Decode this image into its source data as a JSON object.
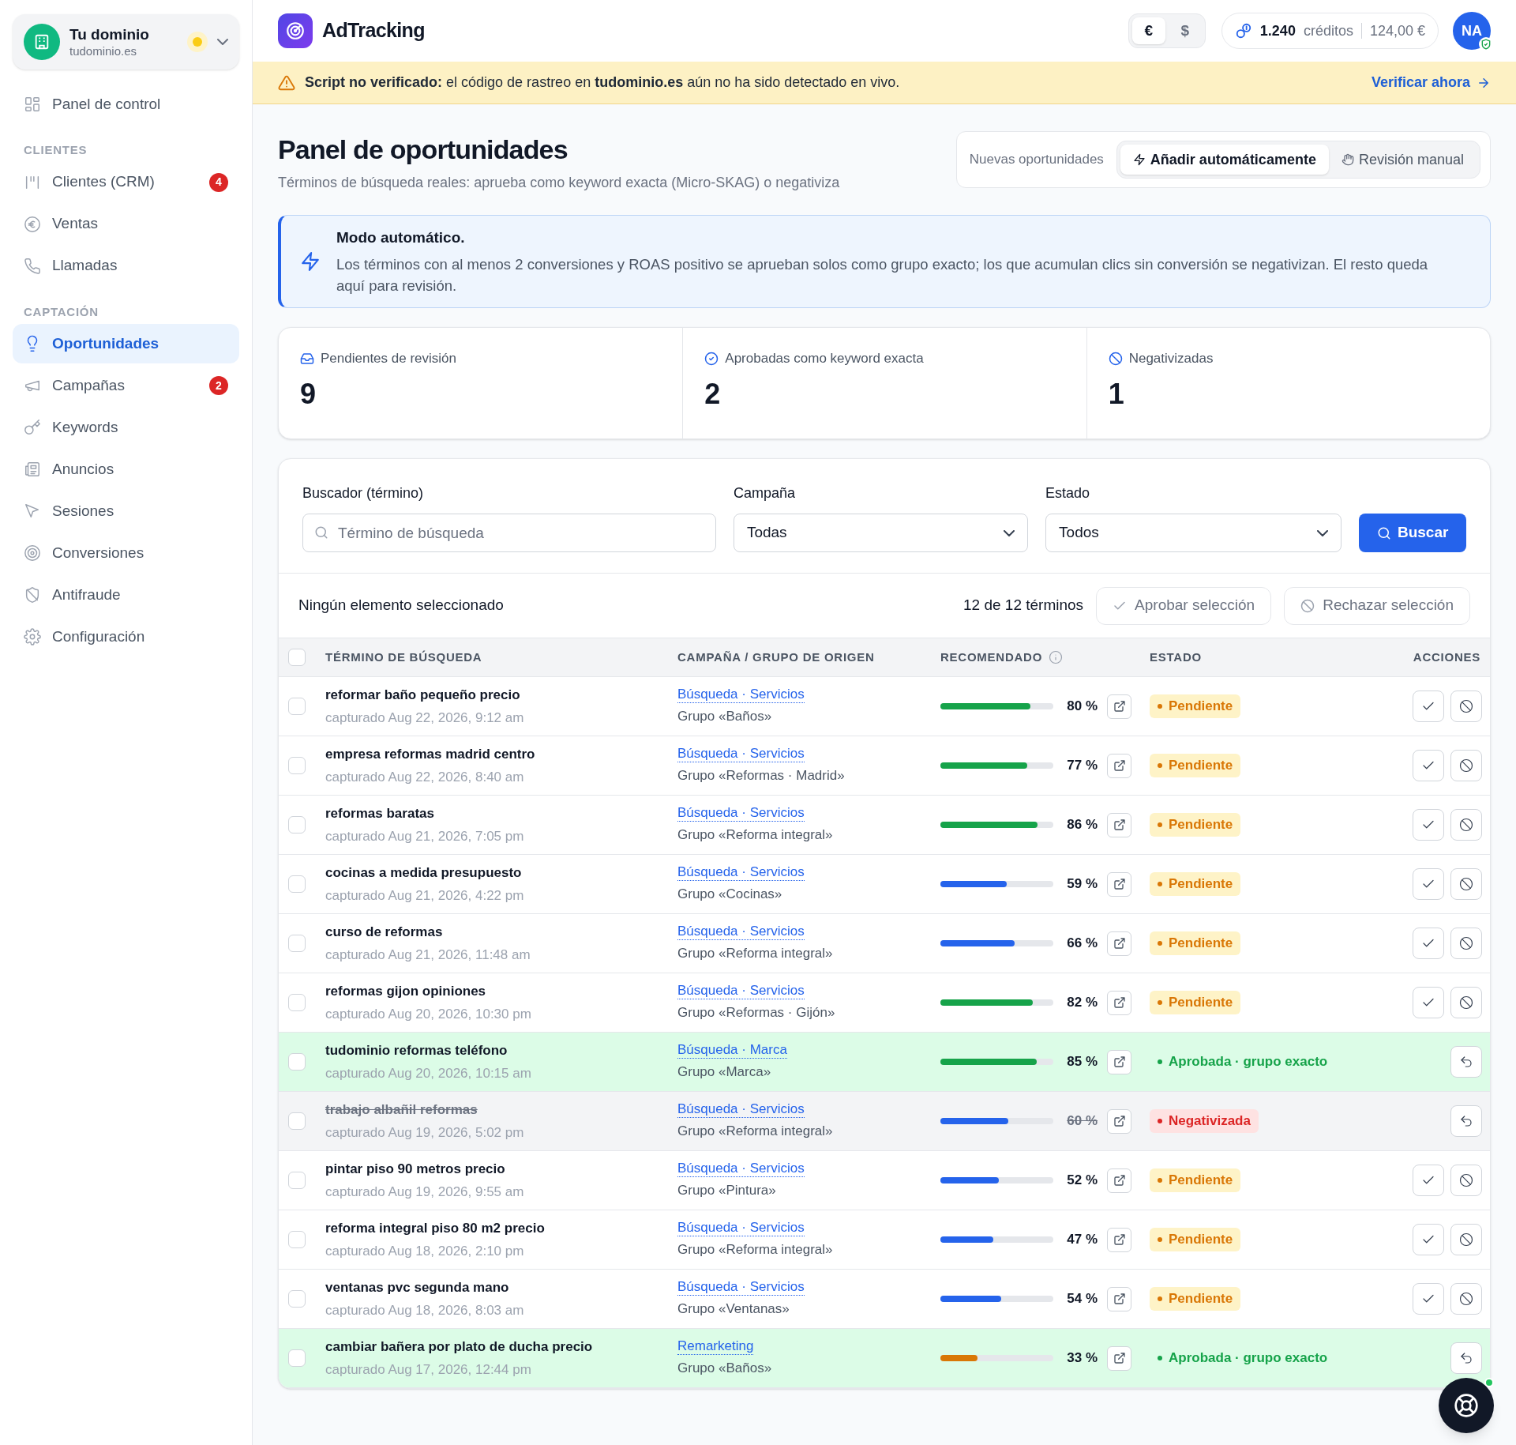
{
  "workspace": {
    "name": "Tu dominio",
    "domain": "tudominio.es"
  },
  "sidebar": {
    "top_items": [
      {
        "label": "Panel de control",
        "selected": false
      }
    ],
    "sections": [
      {
        "title": "CLIENTES",
        "items": [
          {
            "label": "Clientes (CRM)",
            "badge": "4",
            "selected": false
          },
          {
            "label": "Ventas",
            "selected": false
          },
          {
            "label": "Llamadas",
            "selected": false
          }
        ]
      },
      {
        "title": "CAPTACIÓN",
        "items": [
          {
            "label": "Oportunidades",
            "selected": true
          },
          {
            "label": "Campañas",
            "badge": "2",
            "selected": false
          },
          {
            "label": "Keywords",
            "selected": false
          },
          {
            "label": "Anuncios",
            "selected": false
          },
          {
            "label": "Sesiones",
            "selected": false
          },
          {
            "label": "Conversiones",
            "selected": false
          },
          {
            "label": "Antifraude",
            "selected": false
          },
          {
            "label": "Configuración",
            "selected": false
          }
        ]
      }
    ]
  },
  "topbar": {
    "brand": "AdTracking",
    "currencies": [
      {
        "label": "€",
        "selected": true
      },
      {
        "label": "$",
        "selected": false
      }
    ],
    "credits": "1.240",
    "credits_label": "créditos",
    "balance": "124,00 €",
    "avatar": "NA"
  },
  "banner": {
    "text": "**Script no verificado:** el código de rastreo en **tudominio.es** aún no ha sido detectado en vivo.",
    "link": "Verificar ahora"
  },
  "header": {
    "title": "Panel de oportunidades",
    "subtitle": "Términos de búsqueda reales: aprueba como keyword exacta (Micro-SKAG) o negativiza",
    "mode_label": "Nuevas oportunidades",
    "modes": [
      {
        "label": "Añadir automáticamente",
        "selected": true
      },
      {
        "label": "Revisión manual",
        "selected": false
      }
    ]
  },
  "info": {
    "title": "Modo automático.",
    "text": "Los términos con al menos 2 conversiones y ROAS positivo se aprueban solos como grupo exacto; los que acumulan clics sin conversión se negativizan. El resto queda aquí para revisión."
  },
  "stats": [
    {
      "label": "Pendientes de revisión",
      "value": "9"
    },
    {
      "label": "Aprobadas como keyword exacta",
      "value": "2"
    },
    {
      "label": "Negativizadas",
      "value": "1"
    }
  ],
  "filters": {
    "search_label": "Buscador (término)",
    "search_placeholder": "Término de búsqueda",
    "campaign_label": "Campaña",
    "campaign_value": "Todas",
    "status_label": "Estado",
    "status_value": "Todos",
    "button": "Buscar"
  },
  "bulk": {
    "selection": "Ningún elemento seleccionado",
    "count": "12 de 12 términos",
    "approve": "Aprobar selección",
    "reject": "Rechazar selección",
    "disabled": true
  },
  "table": {
    "select_all_checked": false,
    "columns": [
      "TÉRMINO DE BÚSQUEDA",
      "CAMPAÑA / GRUPO DE ORIGEN",
      "RECOMENDADO",
      "ESTADO",
      "ACCIONES"
    ],
    "rows": [
      {
        "term": "reformar baño pequeño precio",
        "captured": "capturado Aug 22, 2026, 9:12 am",
        "campaign": "Búsqueda · Servicios",
        "group": "Grupo «Baños»",
        "level": 0.8,
        "percent": "80 %",
        "status": {
          "kind": "pending",
          "label": "Pendiente"
        },
        "checked": false
      },
      {
        "term": "empresa reformas madrid centro",
        "captured": "capturado Aug 22, 2026, 8:40 am",
        "campaign": "Búsqueda · Servicios",
        "group": "Grupo «Reformas · Madrid»",
        "level": 0.77,
        "percent": "77 %",
        "status": {
          "kind": "pending",
          "label": "Pendiente"
        },
        "checked": false
      },
      {
        "term": "reformas baratas",
        "captured": "capturado Aug 21, 2026, 7:05 pm",
        "campaign": "Búsqueda · Servicios",
        "group": "Grupo «Reforma integral»",
        "level": 0.86,
        "percent": "86 %",
        "status": {
          "kind": "pending",
          "label": "Pendiente"
        },
        "checked": false
      },
      {
        "term": "cocinas a medida presupuesto",
        "captured": "capturado Aug 21, 2026, 4:22 pm",
        "campaign": "Búsqueda · Servicios",
        "group": "Grupo «Cocinas»",
        "level": 0.59,
        "percent": "59 %",
        "status": {
          "kind": "pending",
          "label": "Pendiente"
        },
        "checked": false
      },
      {
        "term": "curso de reformas",
        "captured": "capturado Aug 21, 2026, 11:48 am",
        "campaign": "Búsqueda · Servicios",
        "group": "Grupo «Reforma integral»",
        "level": 0.66,
        "percent": "66 %",
        "status": {
          "kind": "pending",
          "label": "Pendiente"
        },
        "checked": false
      },
      {
        "term": "reformas gijon opiniones",
        "captured": "capturado Aug 20, 2026, 10:30 pm",
        "campaign": "Búsqueda · Servicios",
        "group": "Grupo «Reformas · Gijón»",
        "level": 0.82,
        "percent": "82 %",
        "status": {
          "kind": "pending",
          "label": "Pendiente"
        },
        "checked": false
      },
      {
        "term": "tudominio reformas teléfono",
        "captured": "capturado Aug 20, 2026, 10:15 am",
        "campaign": "Búsqueda · Marca",
        "group": "Grupo «Marca»",
        "level": 0.85,
        "percent": "85 %",
        "status": {
          "kind": "approved",
          "label": "Aprobada · grupo exacto"
        },
        "checked": false
      },
      {
        "term": "trabajo albañil reformas",
        "captured": "capturado Aug 19, 2026, 5:02 pm",
        "campaign": "Búsqueda · Servicios",
        "group": "Grupo «Reforma integral»",
        "level": 0.6,
        "percent": "60 %",
        "status": {
          "kind": "negative",
          "label": "Negativizada"
        },
        "checked": false
      },
      {
        "term": "pintar piso 90 metros precio",
        "captured": "capturado Aug 19, 2026, 9:55 am",
        "campaign": "Búsqueda · Servicios",
        "group": "Grupo «Pintura»",
        "level": 0.52,
        "percent": "52 %",
        "status": {
          "kind": "pending",
          "label": "Pendiente"
        },
        "checked": false
      },
      {
        "term": "reforma integral piso 80 m2 precio",
        "captured": "capturado Aug 18, 2026, 2:10 pm",
        "campaign": "Búsqueda · Servicios",
        "group": "Grupo «Reforma integral»",
        "level": 0.47,
        "percent": "47 %",
        "status": {
          "kind": "pending",
          "label": "Pendiente"
        },
        "checked": false
      },
      {
        "term": "ventanas pvc segunda mano",
        "captured": "capturado Aug 18, 2026, 8:03 am",
        "campaign": "Búsqueda · Servicios",
        "group": "Grupo «Ventanas»",
        "level": 0.54,
        "percent": "54 %",
        "status": {
          "kind": "pending",
          "label": "Pendiente"
        },
        "checked": false
      },
      {
        "term": "cambiar bañera por plato de ducha precio",
        "captured": "capturado Aug 17, 2026, 12:44 pm",
        "campaign": "Remarketing",
        "group": "Grupo «Baños»",
        "level": 0.33,
        "percent": "33 %",
        "status": {
          "kind": "approved",
          "label": "Aprobada · grupo exacto"
        },
        "checked": false
      }
    ]
  }
}
